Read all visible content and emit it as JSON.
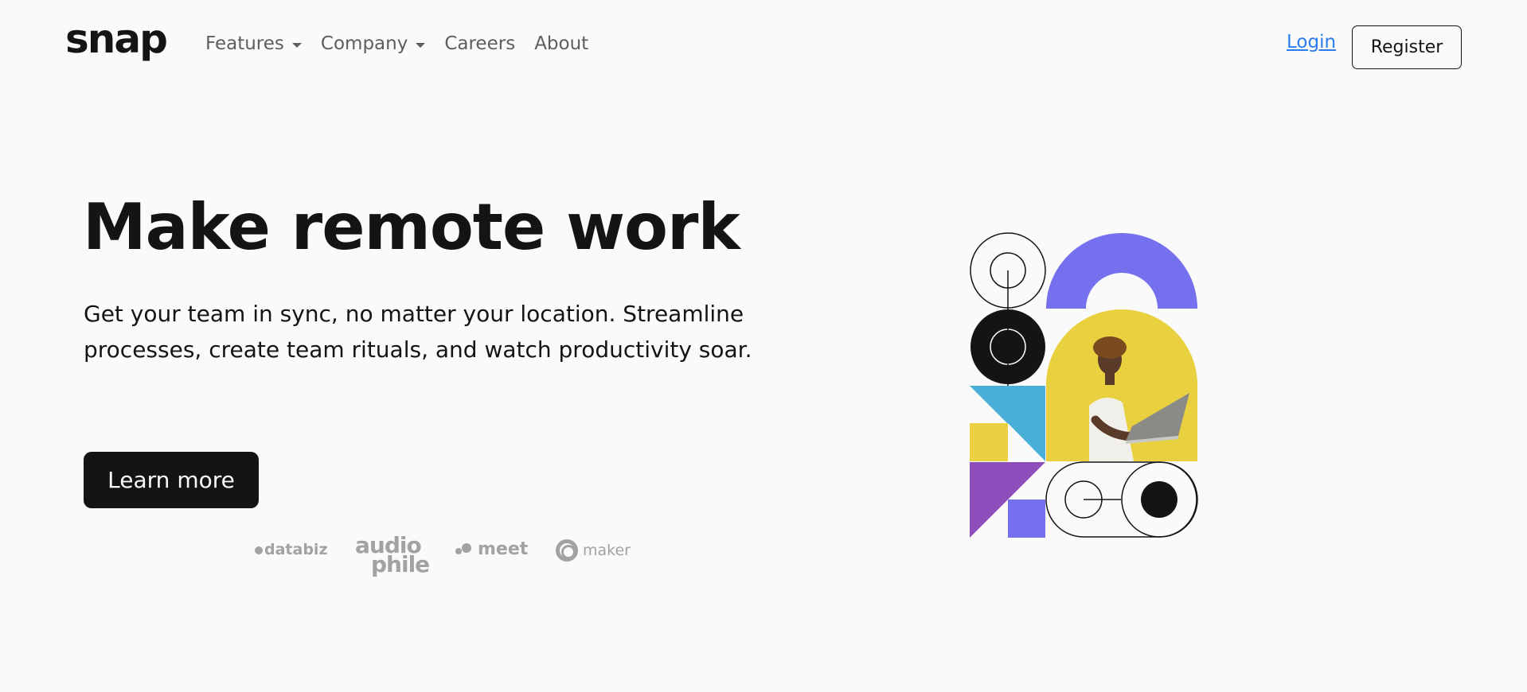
{
  "nav": {
    "logo": "snap",
    "links": [
      {
        "label": "Features",
        "has_dropdown": true
      },
      {
        "label": "Company",
        "has_dropdown": true
      },
      {
        "label": "Careers",
        "has_dropdown": false
      },
      {
        "label": "About",
        "has_dropdown": false
      }
    ],
    "login_label": "Login",
    "register_label": "Register"
  },
  "hero": {
    "title": "Make remote work",
    "description": "Get your team in sync, no matter your location. Streamline processes, create team rituals, and watch productivity soar.",
    "cta_label": "Learn more"
  },
  "clients": {
    "databiz": "databiz",
    "audiophile_line1": "audio",
    "audiophile_line2": "phile",
    "meet": "meet",
    "maker": "maker"
  },
  "colors": {
    "background": "#fafafa",
    "text": "#141414",
    "nav_text": "#5e5e5e",
    "link_blue": "#2b7cf0",
    "purple": "#7570ed",
    "violet": "#8d4ebb",
    "yellow": "#ebd141",
    "blue": "#4aafd8",
    "logo_gray": "#a2a2a2"
  },
  "illustration": {
    "icon": "geometric-person-with-laptop-illustration"
  }
}
